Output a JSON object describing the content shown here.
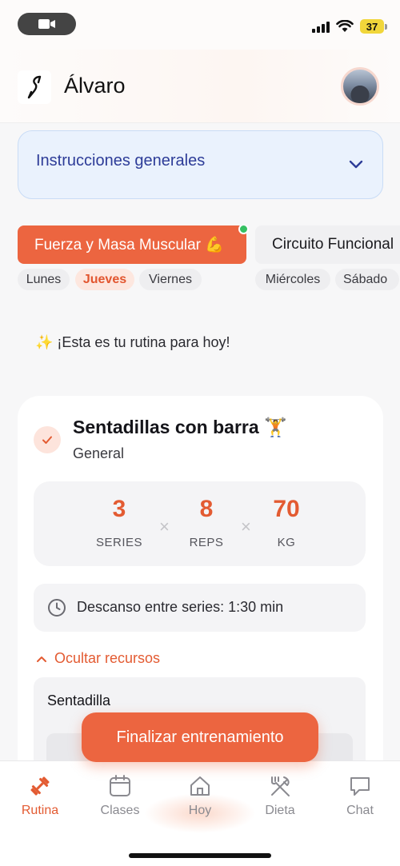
{
  "status_bar": {
    "battery": "37"
  },
  "header": {
    "user_name": "Álvaro"
  },
  "instructions": {
    "title": "Instrucciones generales"
  },
  "routines": [
    {
      "name": "Fuerza y Masa Muscular 💪",
      "active": true,
      "days": [
        "Lunes",
        "Jueves",
        "Viernes"
      ],
      "today": "Jueves"
    },
    {
      "name": "Circuito Funcional",
      "active": false,
      "days": [
        "Miércoles",
        "Sábado"
      ]
    }
  ],
  "today_message": "✨ ¡Esta es tu rutina para hoy!",
  "exercise": {
    "title": "Sentadillas con barra 🏋️",
    "subtitle": "General",
    "stats": [
      {
        "value": "3",
        "label": "SERIES"
      },
      {
        "value": "8",
        "label": "REPS"
      },
      {
        "value": "70",
        "label": "KG"
      }
    ],
    "rest": "Descanso entre series: 1:30 min",
    "toggle_resources": "Ocultar recursos",
    "resource_title": "Sentadilla"
  },
  "cta": {
    "label": "Finalizar entrenamiento"
  },
  "tabbar": [
    {
      "label": "Rutina",
      "icon": "dumbbell-icon",
      "active": true
    },
    {
      "label": "Clases",
      "icon": "calendar-icon",
      "active": false
    },
    {
      "label": "Hoy",
      "icon": "home-icon",
      "active": false
    },
    {
      "label": "Dieta",
      "icon": "fork-knife-icon",
      "active": false
    },
    {
      "label": "Chat",
      "icon": "chat-icon",
      "active": false
    }
  ],
  "colors": {
    "accent": "#ec6540",
    "instructions_bg": "#eaf2fd",
    "instructions_text": "#2d3c98",
    "online": "#35c062"
  }
}
